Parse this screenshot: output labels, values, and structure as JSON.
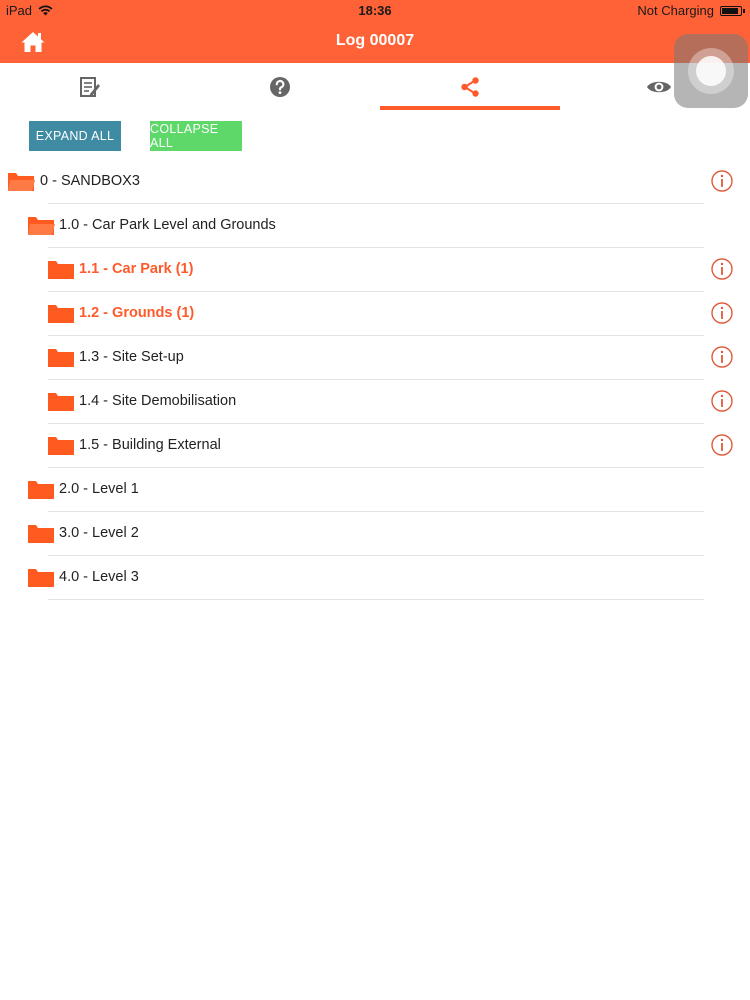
{
  "status_bar": {
    "device": "iPad",
    "time": "18:36",
    "battery_status": "Not Charging"
  },
  "nav": {
    "title": "Log 00007",
    "home_icon": "home-icon"
  },
  "tabs": [
    {
      "name": "form",
      "icon": "edit-form-icon",
      "selected": false
    },
    {
      "name": "help",
      "icon": "question-icon",
      "selected": false
    },
    {
      "name": "share",
      "icon": "share-icon",
      "selected": true
    },
    {
      "name": "view",
      "icon": "eye-icon",
      "selected": false
    }
  ],
  "actions": {
    "expand_all": "EXPAND ALL",
    "collapse_all": "COLLAPSE ALL"
  },
  "tree": [
    {
      "label": "0 - SANDBOX3",
      "level": 0,
      "expanded": true,
      "highlight": false,
      "info": true
    },
    {
      "label": "1.0 - Car Park Level and Grounds",
      "level": 1,
      "expanded": true,
      "highlight": false,
      "info": false
    },
    {
      "label": "1.1 - Car Park (1)",
      "level": 2,
      "expanded": false,
      "highlight": true,
      "info": true
    },
    {
      "label": "1.2 - Grounds (1)",
      "level": 2,
      "expanded": false,
      "highlight": true,
      "info": true
    },
    {
      "label": "1.3 - Site Set-up",
      "level": 2,
      "expanded": false,
      "highlight": false,
      "info": true
    },
    {
      "label": "1.4 - Site Demobilisation",
      "level": 2,
      "expanded": false,
      "highlight": false,
      "info": true
    },
    {
      "label": "1.5 - Building External",
      "level": 2,
      "expanded": false,
      "highlight": false,
      "info": true
    },
    {
      "label": "2.0 - Level 1",
      "level": 1,
      "expanded": false,
      "highlight": false,
      "info": false
    },
    {
      "label": "3.0 - Level 2",
      "level": 1,
      "expanded": false,
      "highlight": false,
      "info": false
    },
    {
      "label": "4.0 - Level 3",
      "level": 1,
      "expanded": false,
      "highlight": false,
      "info": false
    }
  ],
  "colors": {
    "accent": "#ff6236",
    "highlight_text": "#ff5a2c",
    "expand_button": "#3f8ba3",
    "collapse_button": "#5fd86a",
    "folder": "#ff5a1f",
    "icon_gray": "#666666"
  }
}
